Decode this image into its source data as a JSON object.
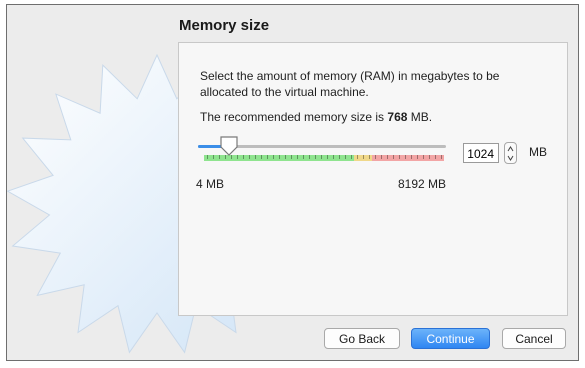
{
  "page": {
    "title": "Memory size",
    "description": "Select the amount of memory (RAM) in megabytes to be allocated to the virtual machine.",
    "recommend_prefix": "The recommended memory size is ",
    "recommend_value": "768",
    "recommend_suffix": " MB."
  },
  "memory": {
    "value": "1024",
    "unit": "MB",
    "min_label": "4 MB",
    "max_label": "8192 MB",
    "slider_fraction": 0.125
  },
  "buttons": {
    "back": "Go Back",
    "continue": "Continue",
    "cancel": "Cancel"
  },
  "colors": {
    "accent": "#2f86f2",
    "range_green": "#8fe48f",
    "range_yellow": "#f0d88a",
    "range_red": "#f2a5a5"
  },
  "icons": {
    "background": "virtualbox-star-icon",
    "stepper_up": "chevron-up-icon",
    "stepper_down": "chevron-down-icon"
  }
}
